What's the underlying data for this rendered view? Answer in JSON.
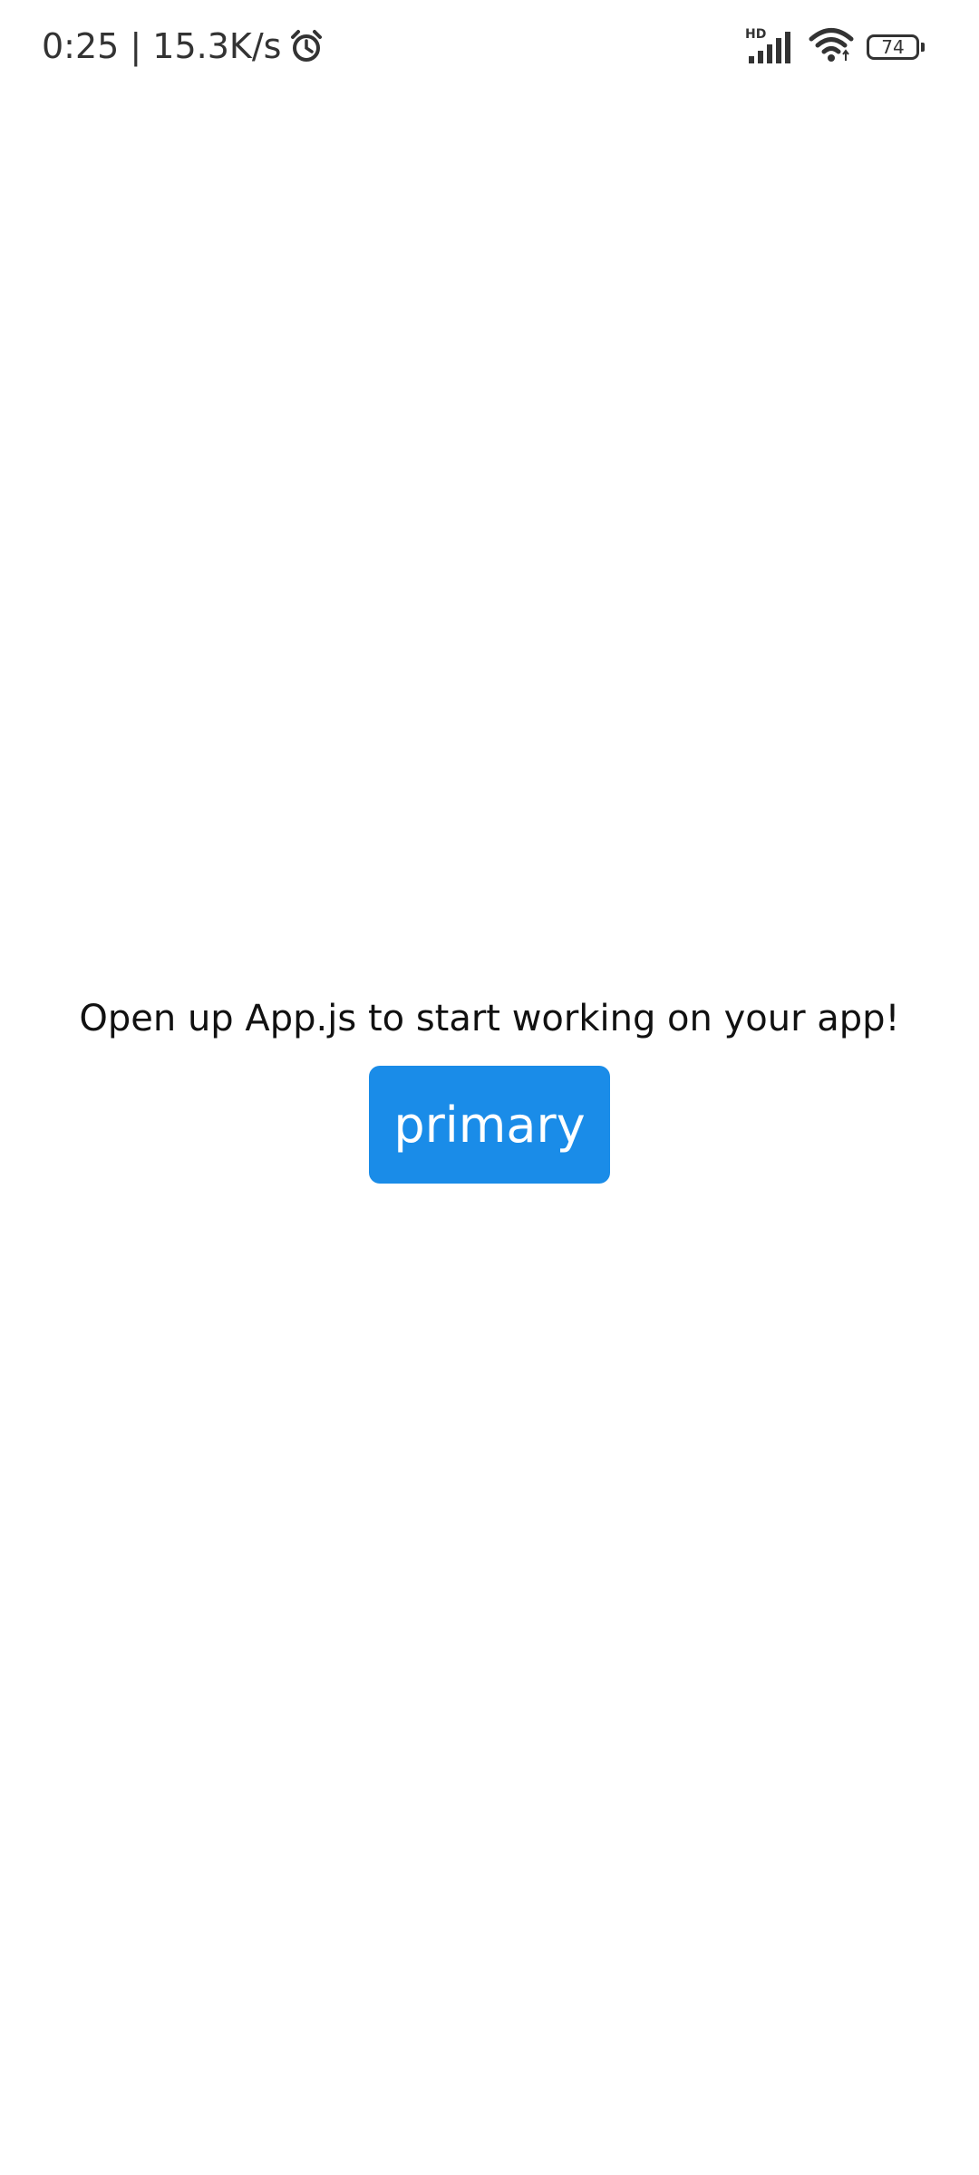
{
  "status_bar": {
    "time_speed": "0:25 | 15.3K/s",
    "alarm_icon": "alarm-clock-icon",
    "signal_label": "HD",
    "signal_icon": "cellular-signal-icon",
    "wifi_icon": "wifi-icon",
    "battery_level": "74",
    "battery_icon": "battery-icon"
  },
  "main": {
    "message": "Open up App.js to start working on your app!",
    "primary_button_label": "primary"
  },
  "colors": {
    "accent": "#1a8ce8",
    "background": "#ffffff",
    "text": "#111111"
  }
}
